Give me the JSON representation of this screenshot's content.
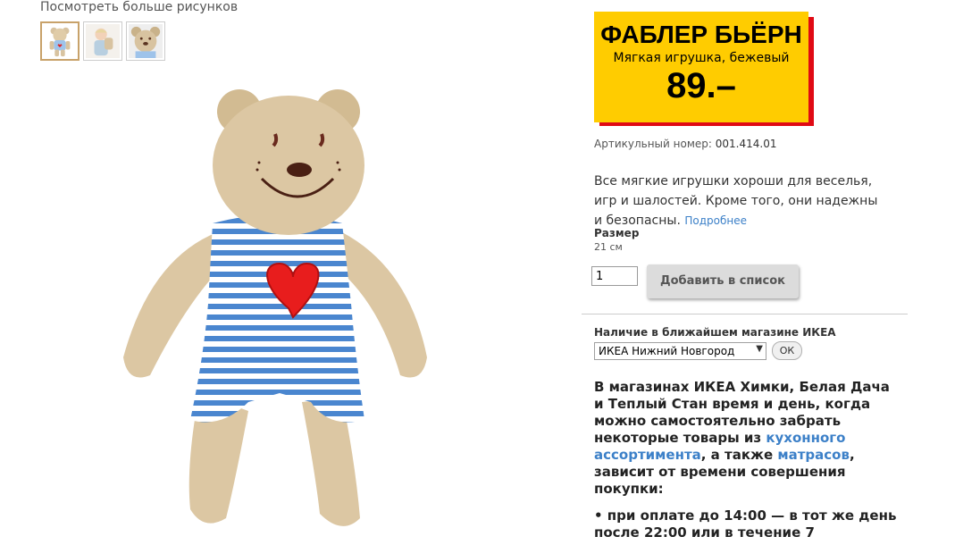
{
  "gallery": {
    "more_images_label": "Посмотреть больше рисунков",
    "thumbnails": [
      "bear-front-thumb",
      "child-with-bear-thumb",
      "bear-face-thumb"
    ],
    "selected_index": 0
  },
  "product": {
    "name": "ФАБЛЕР БЬЁРН",
    "type": "Мягкая игрушка, бежевый",
    "price": "89.–",
    "article_label": "Артикульный номер:",
    "article_number": "001.414.01",
    "description": "Все мягкие игрушки хороши для веселья, игр и шалостей. Кроме того, они надежны и безопасны.",
    "more_link": "Подробнее",
    "size_label": "Размер",
    "size_value": "21 см"
  },
  "cart": {
    "quantity": "1",
    "add_button_label": "Добавить в список"
  },
  "availability": {
    "label": "Наличие в ближайшем магазине ИКЕА",
    "selected_store": "ИКЕА Нижний Новгород",
    "ok_label": "ОК"
  },
  "pickup": {
    "text_1": "В магазинах ИКЕА Химки, Белая Дача и Теплый Стан время и день, когда можно самостоятельно забрать некоторые товары из ",
    "link_1": "кухонного ассортимента",
    "text_2": ", а также ",
    "link_2": "матрасов",
    "text_3": ", зависит от времени совершения покупки:",
    "bullet": "• при оплате до 14:00 — в тот же день после 22:00 или в течение 7"
  },
  "colors": {
    "price_box": "#ffcc00",
    "price_shadow": "#e00a14",
    "link": "#3c80c8"
  }
}
